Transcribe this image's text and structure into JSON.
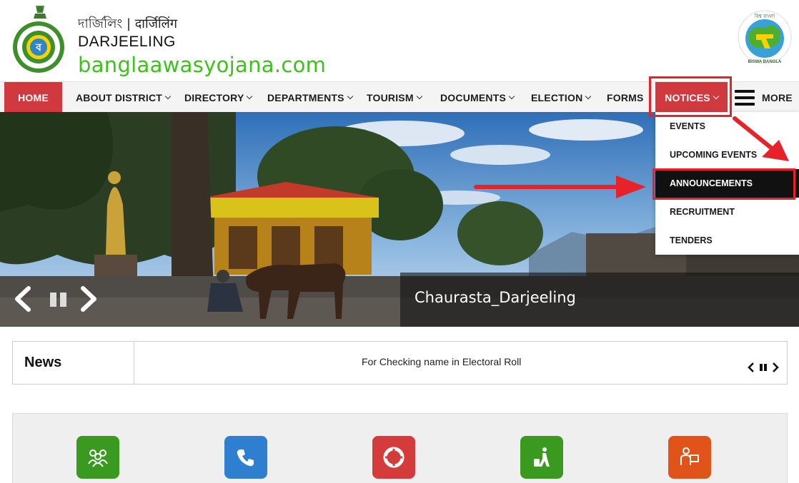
{
  "header": {
    "title_local": "দার্জিলিং | दार्जिलिंग",
    "title_en": "DARJEELING",
    "site_url": "banglaawasyojana.com",
    "emblem_icon": "wb-government-emblem-icon",
    "brand_icon": "biswa-bangla-logo-icon"
  },
  "nav": {
    "home": "HOME",
    "about": "ABOUT DISTRICT",
    "directory": "DIRECTORY",
    "departments": "DEPARTMENTS",
    "tourism": "TOURISM",
    "documents": "DOCUMENTS",
    "election": "ELECTION",
    "forms": "FORMS",
    "notices": "NOTICES",
    "more": "MORE",
    "accent_color": "#d03a3f"
  },
  "notices_menu": {
    "items": [
      "EVENTS",
      "UPCOMING EVENTS",
      "ANNOUNCEMENTS",
      "RECRUITMENT",
      "TENDERS"
    ],
    "active": "ANNOUNCEMENTS"
  },
  "slider": {
    "caption": "Chaurasta_Darjeeling"
  },
  "news": {
    "label": "News",
    "headline": "For Checking name in Electoral Roll"
  },
  "services": {
    "items": [
      {
        "icon": "people-group-icon",
        "color": "#3a9a1f"
      },
      {
        "icon": "phone-icon",
        "color": "#2f7fd0"
      },
      {
        "icon": "lifebuoy-icon",
        "color": "#d43b3b"
      },
      {
        "icon": "traveler-luggage-icon",
        "color": "#3a9a1f"
      },
      {
        "icon": "delivery-person-icon",
        "color": "#e0541a"
      }
    ]
  },
  "annotation_color": "#e8222a"
}
